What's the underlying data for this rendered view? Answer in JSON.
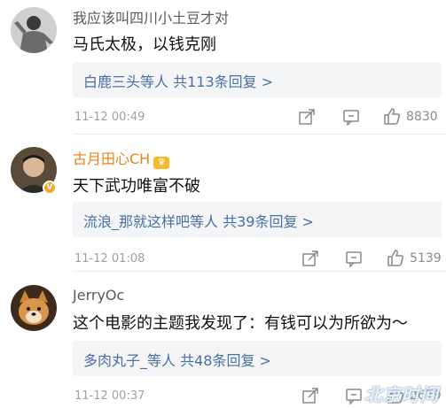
{
  "comments": [
    {
      "username": "我应该叫四川小土豆才对",
      "text": "马氏太极，以钱克刚",
      "replies": "白鹿三头等人  共113条回复 >",
      "time": "11-12 00:49",
      "likes": "8830",
      "avatar_icon": "martial-artist-avatar"
    },
    {
      "username": "古月田心CH",
      "text": "天下武功唯富不破",
      "replies": "流浪_那就这样吧等人  共39条回复 >",
      "time": "11-12 01:08",
      "likes": "5139",
      "avatar_icon": "man-avatar",
      "verified": true
    },
    {
      "username": "JerryOc",
      "text": "这个电影的主题我发现了：有钱可以为所欲为～",
      "replies": "多肉丸子_等人  共48条回复 >",
      "time": "11-12 00:37",
      "likes": "2679",
      "avatar_icon": "shiba-dog-avatar"
    }
  ],
  "colors": {
    "link": "#4a6fa5",
    "vip_name": "#e8821c",
    "reply_bg": "#f4f5f7",
    "meta": "#a0a0a0"
  },
  "watermark": "北京时间"
}
